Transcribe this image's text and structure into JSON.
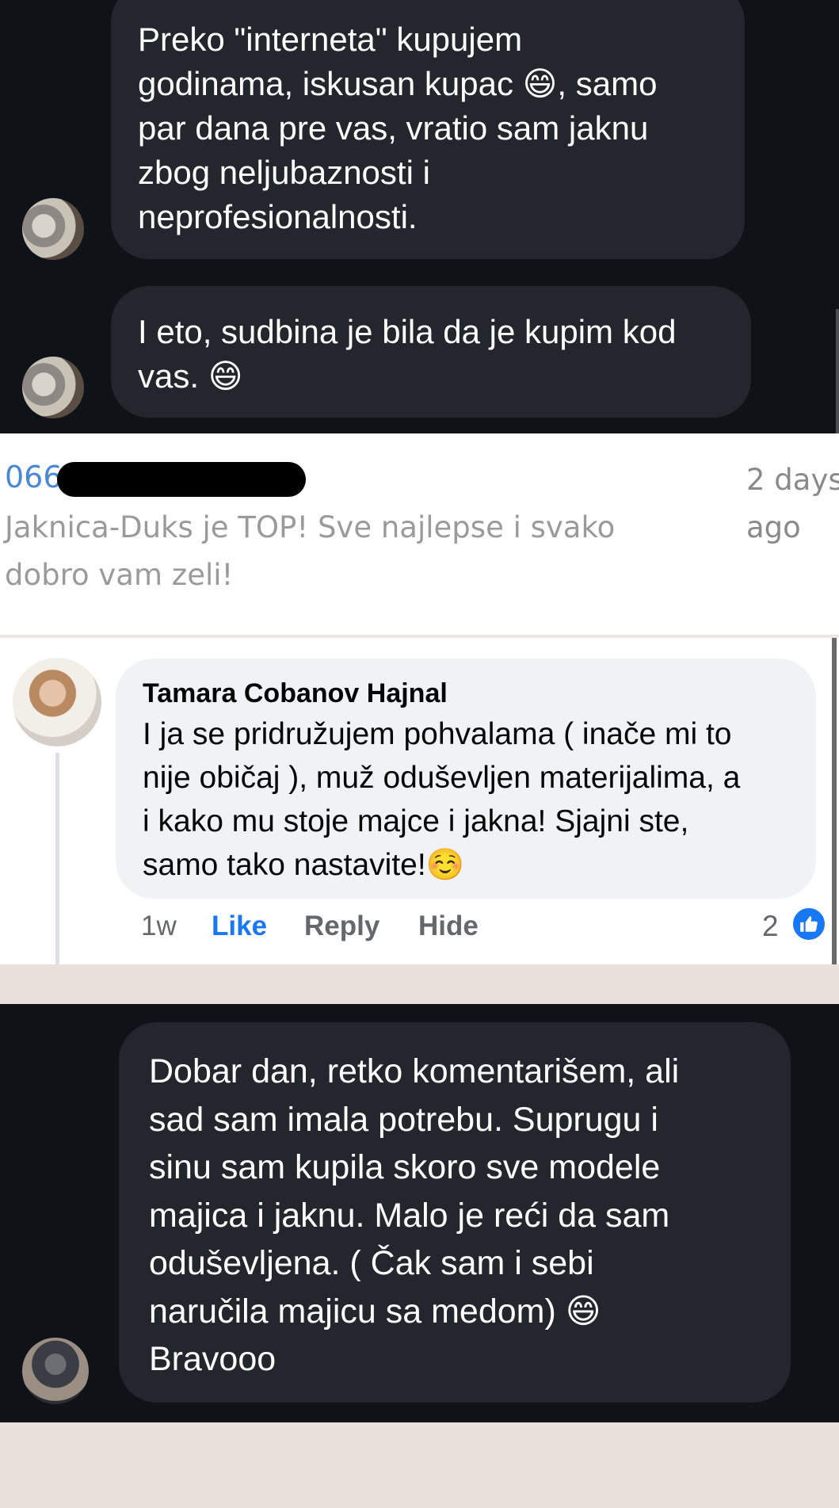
{
  "chat_top": {
    "messages": [
      {
        "text": "Preko \"interneta\" kupujem\ngodinama, iskusan kupac 😄, samo\npar dana pre vas, vratio sam jaknu\nzbog neljubaznosti i\nneprofesionalnosti."
      },
      {
        "text": "I eto, sudbina je bila da je kupim kod\nvas. 😄"
      }
    ]
  },
  "review": {
    "phone_prefix": "066",
    "time_ago": "2 days\nago",
    "text": "Jaknica-Duks je TOP! Sve najlepse i svako\ndobro vam zeli!"
  },
  "fb_comment": {
    "author": "Tamara Cobanov Hajnal",
    "text": "I ja se pridružujem pohvalama ( inače mi to\nnije običaj ), muž oduševljen materijalima, a\ni kako mu stoje majce i jakna! Sjajni ste,\nsamo tako nastavite!☺️",
    "time": "1w",
    "like_label": "Like",
    "reply_label": "Reply",
    "hide_label": "Hide",
    "reaction_count": "2",
    "reaction_icon": "thumbs-up-icon",
    "accent_color": "#1877f2"
  },
  "chat_bottom": {
    "message": "Dobar dan, retko komentarišem, ali\nsad sam imala potrebu. Suprugu i\nsinu sam kupila skoro sve modele\nmajica i jaknu. Malo je reći da sam\noduševljena. ( Čak sam i sebi\nnaručila majicu sa medom) 😄\nBravooo"
  }
}
